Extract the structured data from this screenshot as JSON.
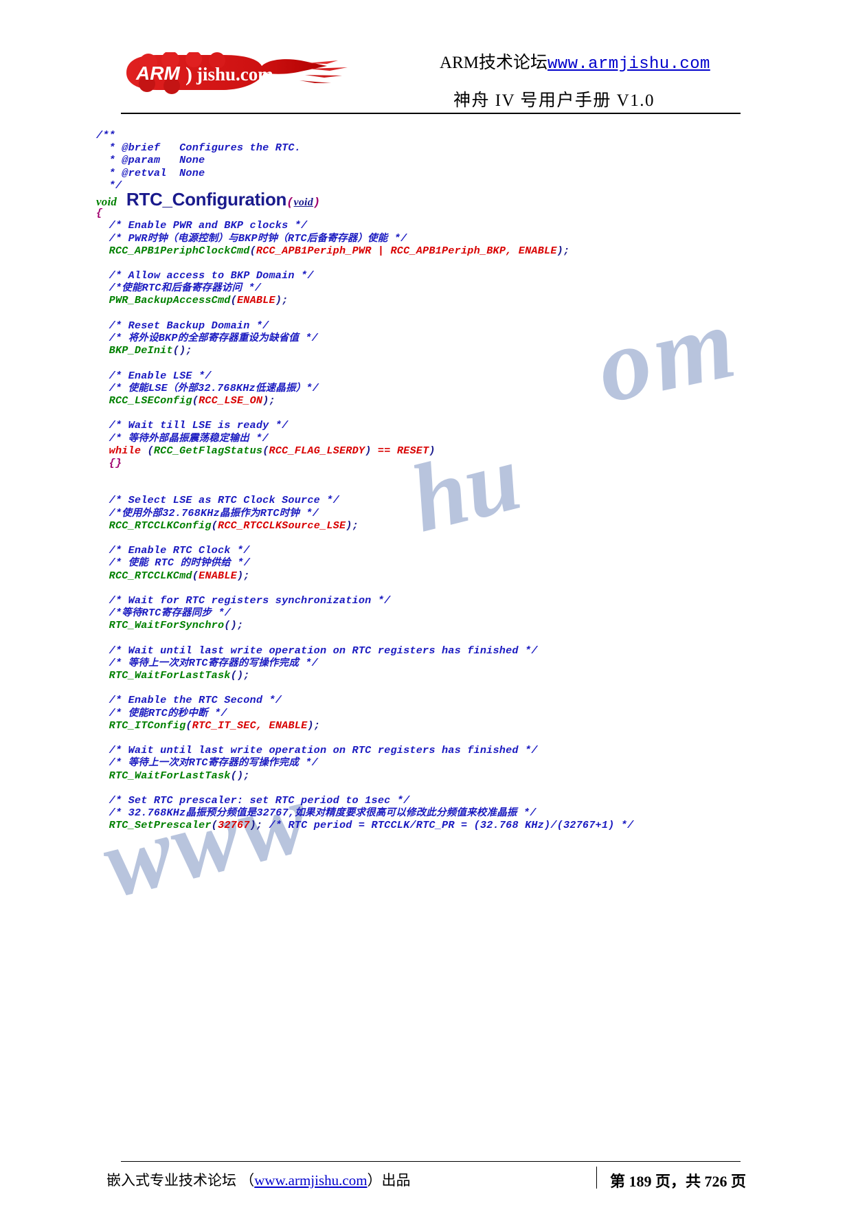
{
  "header": {
    "logo_text_main": "ARM",
    "logo_text_sub": "jishu.com",
    "site_label": "ARM技术论坛",
    "site_url": "www.armjishu.com",
    "doc_title": "神舟 IV 号用户手册  V1.0"
  },
  "footer": {
    "left_prefix": "嵌入式专业技术论坛  （",
    "left_link": "www.armjishu.com",
    "left_suffix": "）出品",
    "page_info": "第 189 页，共 726 页"
  },
  "watermark": {
    "text1": "om",
    "text2": "hu",
    "text3": "www"
  },
  "code": {
    "lines": [
      {
        "t": "doc",
        "text": "/**"
      },
      {
        "t": "doc",
        "text": "  * @brief   Configures the RTC."
      },
      {
        "t": "doc",
        "text": "  * @param   None"
      },
      {
        "t": "doc",
        "text": "  * @retval  None"
      },
      {
        "t": "doc",
        "text": "  */"
      },
      {
        "t": "sig",
        "kw": "void",
        "name": "RTC_Configuration",
        "args": "void"
      },
      {
        "t": "brace",
        "text": "{"
      },
      {
        "t": "comment",
        "text": "  /* Enable PWR and BKP clocks */"
      },
      {
        "t": "comment",
        "text": "  /* PWR时钟（电源控制）与BKP时钟（RTC后备寄存器）使能 */"
      },
      {
        "t": "call",
        "indent": "  ",
        "fn": "RCC_APB1PeriphClockCmd",
        "args": "RCC_APB1Periph_PWR | RCC_APB1Periph_BKP, ENABLE"
      },
      {
        "t": "blank"
      },
      {
        "t": "comment",
        "text": "  /* Allow access to BKP Domain */"
      },
      {
        "t": "comment",
        "text": "  /*使能RTC和后备寄存器访问 */"
      },
      {
        "t": "call",
        "indent": "  ",
        "fn": "PWR_BackupAccessCmd",
        "args": "ENABLE"
      },
      {
        "t": "blank"
      },
      {
        "t": "comment",
        "text": "  /* Reset Backup Domain */"
      },
      {
        "t": "comment",
        "text": "  /* 将外设BKP的全部寄存器重设为缺省值 */"
      },
      {
        "t": "call",
        "indent": "  ",
        "fn": "BKP_DeInit",
        "args": ""
      },
      {
        "t": "blank"
      },
      {
        "t": "comment",
        "text": "  /* Enable LSE */"
      },
      {
        "t": "comment",
        "text": "  /* 使能LSE（外部32.768KHz低速晶振）*/"
      },
      {
        "t": "call",
        "indent": "  ",
        "fn": "RCC_LSEConfig",
        "args": "RCC_LSE_ON"
      },
      {
        "t": "blank"
      },
      {
        "t": "comment",
        "text": "  /* Wait till LSE is ready */"
      },
      {
        "t": "comment",
        "text": "  /* 等待外部晶振震荡稳定输出 */"
      },
      {
        "t": "while",
        "indent": "  ",
        "kw": "while",
        "fn": "RCC_GetFlagStatus",
        "args": "RCC_FLAG_LSERDY",
        "tail": "== RESET"
      },
      {
        "t": "brace",
        "text": "  {}"
      },
      {
        "t": "blank"
      },
      {
        "t": "blank"
      },
      {
        "t": "comment",
        "text": "  /* Select LSE as RTC Clock Source */"
      },
      {
        "t": "comment",
        "text": "  /*使用外部32.768KHz晶振作为RTC时钟 */"
      },
      {
        "t": "call",
        "indent": "  ",
        "fn": "RCC_RTCCLKConfig",
        "args": "RCC_RTCCLKSource_LSE"
      },
      {
        "t": "blank"
      },
      {
        "t": "comment",
        "text": "  /* Enable RTC Clock */"
      },
      {
        "t": "comment",
        "text": "  /* 使能 RTC 的时钟供给 */"
      },
      {
        "t": "call",
        "indent": "  ",
        "fn": "RCC_RTCCLKCmd",
        "args": "ENABLE"
      },
      {
        "t": "blank"
      },
      {
        "t": "comment",
        "text": "  /* Wait for RTC registers synchronization */"
      },
      {
        "t": "comment",
        "text": "  /*等待RTC寄存器同步 */"
      },
      {
        "t": "call",
        "indent": "  ",
        "fn": "RTC_WaitForSynchro",
        "args": ""
      },
      {
        "t": "blank"
      },
      {
        "t": "comment",
        "text": "  /* Wait until last write operation on RTC registers has finished */"
      },
      {
        "t": "comment",
        "text": "  /* 等待上一次对RTC寄存器的写操作完成 */"
      },
      {
        "t": "call",
        "indent": "  ",
        "fn": "RTC_WaitForLastTask",
        "args": ""
      },
      {
        "t": "blank"
      },
      {
        "t": "comment",
        "text": "  /* Enable the RTC Second */"
      },
      {
        "t": "comment",
        "text": "  /* 使能RTC的秒中断 */"
      },
      {
        "t": "call",
        "indent": "  ",
        "fn": "RTC_ITConfig",
        "args": "RTC_IT_SEC, ENABLE"
      },
      {
        "t": "blank"
      },
      {
        "t": "comment",
        "text": "  /* Wait until last write operation on RTC registers has finished */"
      },
      {
        "t": "comment",
        "text": "  /* 等待上一次对RTC寄存器的写操作完成 */"
      },
      {
        "t": "call",
        "indent": "  ",
        "fn": "RTC_WaitForLastTask",
        "args": ""
      },
      {
        "t": "blank"
      },
      {
        "t": "comment",
        "text": "  /* Set RTC prescaler: set RTC period to 1sec */"
      },
      {
        "t": "comment",
        "text": "  /* 32.768KHz晶振预分频值是32767,如果对精度要求很高可以修改此分频值来校准晶振 */"
      },
      {
        "t": "prescaler",
        "indent": "  ",
        "fn": "RTC_SetPrescaler",
        "args": "32767",
        "comment": " /* RTC period = RTCCLK/RTC_PR = (32.768 KHz)/(32767+1) */"
      }
    ]
  },
  "colors": {
    "comment": "#1a1ac0",
    "function": "#008000",
    "constant": "#d80000",
    "punctuation": "#1a1a8c",
    "brace": "#a0006e",
    "link": "#0000cc",
    "logo_red": "#d82020"
  }
}
